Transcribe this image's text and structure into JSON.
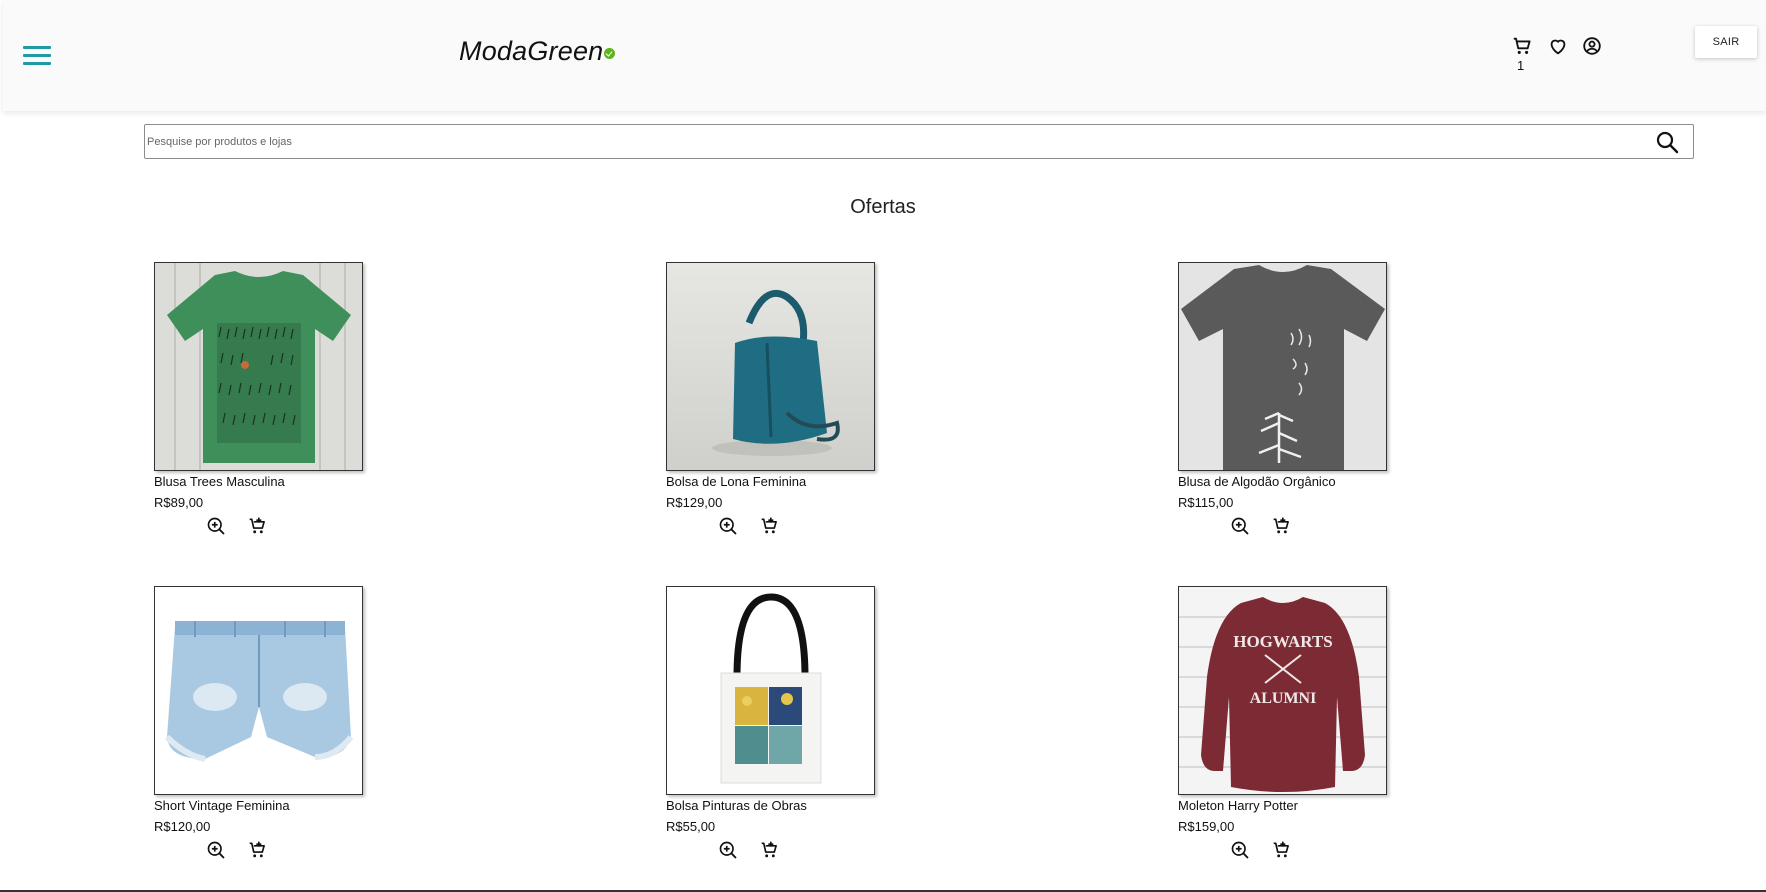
{
  "header": {
    "logo_text": "ModaGreen",
    "cart_count": "1",
    "logout_label": "SAIR",
    "accent_color": "#1f9aa5",
    "logo_dot_color": "#5cb51c"
  },
  "search": {
    "placeholder": "Pesquise por produtos e lojas",
    "value": ""
  },
  "section": {
    "title": "Ofertas"
  },
  "products": [
    {
      "name": "Blusa Trees Masculina",
      "price": "R$89,00",
      "image": "green-tshirt-trees"
    },
    {
      "name": "Bolsa de Lona Feminina",
      "price": "R$129,00",
      "image": "teal-canvas-bag"
    },
    {
      "name": "Blusa de Algodão Orgânico",
      "price": "R$115,00",
      "image": "grey-tshirt-tree"
    },
    {
      "name": "Short Vintage Feminina",
      "price": "R$120,00",
      "image": "denim-shorts"
    },
    {
      "name": "Bolsa Pinturas de Obras",
      "price": "R$55,00",
      "image": "tote-bag-paintings"
    },
    {
      "name": "Moleton Harry Potter",
      "price": "R$159,00",
      "image": "maroon-sweatshirt",
      "image_text": [
        "HOGWARTS",
        "ALUMNI"
      ]
    }
  ]
}
